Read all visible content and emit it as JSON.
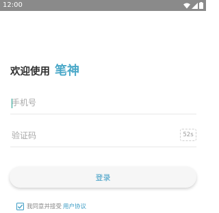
{
  "status_bar": {
    "time": "12:00",
    "icons": [
      "wifi-icon",
      "cell-signal-icon",
      "battery-icon"
    ]
  },
  "header": {
    "prefix": "欢迎使用",
    "brand": "笔神"
  },
  "form": {
    "phone_placeholder": "手机号",
    "code_placeholder": "验证码",
    "sms_countdown": "52s"
  },
  "actions": {
    "login_label": "登录"
  },
  "agreement": {
    "checked": true,
    "text": "我同意并接受",
    "link": "用户协议"
  },
  "colors": {
    "accent": "#4aa8c8",
    "status_bar": "#8a8a8a"
  }
}
